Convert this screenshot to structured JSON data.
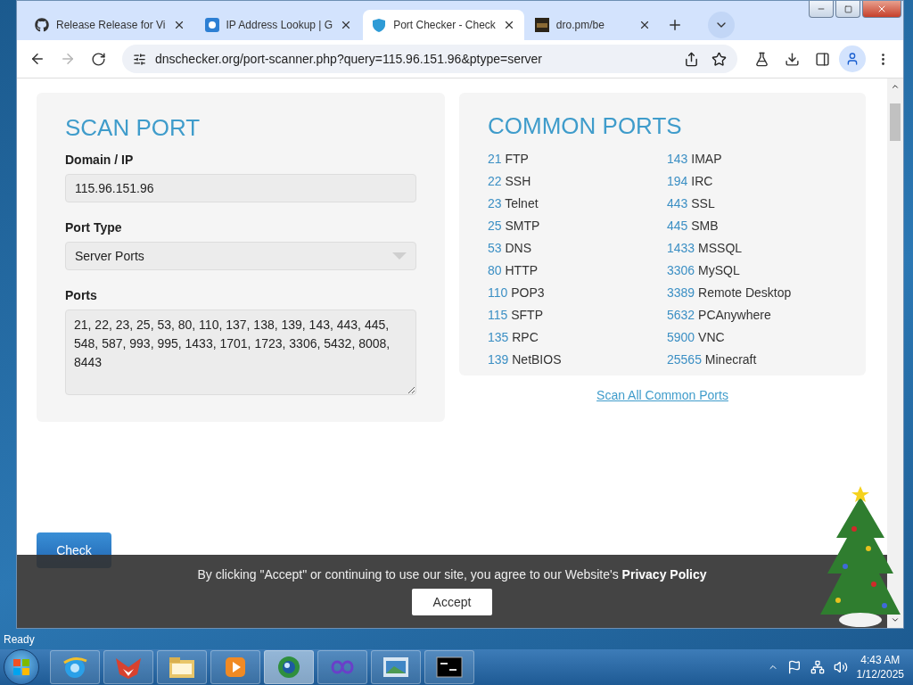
{
  "tabs": [
    {
      "title": "Release Release for Vi",
      "selected": false
    },
    {
      "title": "IP Address Lookup | G",
      "selected": false
    },
    {
      "title": "Port Checker - Check",
      "selected": true
    },
    {
      "title": "dro.pm/be",
      "selected": false
    }
  ],
  "toolbar": {
    "url": "dnschecker.org/port-scanner.php?query=115.96.151.96&ptype=server",
    "forward_disabled": true
  },
  "scan_port": {
    "title": "SCAN PORT",
    "domain_label": "Domain / IP",
    "domain_value": "115.96.151.96",
    "port_type_label": "Port Type",
    "port_type_value": "Server Ports",
    "ports_label": "Ports",
    "ports_value": "21, 22, 23, 25, 53, 80, 110, 137, 138, 139, 143, 443, 445, 548, 587, 993, 995, 1433, 1701, 1723, 3306, 5432, 8008, 8443"
  },
  "common_ports": {
    "title": "COMMON PORTS",
    "columns": [
      [
        {
          "port": "21",
          "name": "FTP"
        },
        {
          "port": "22",
          "name": "SSH"
        },
        {
          "port": "23",
          "name": "Telnet"
        },
        {
          "port": "25",
          "name": "SMTP"
        },
        {
          "port": "53",
          "name": "DNS"
        },
        {
          "port": "80",
          "name": "HTTP"
        },
        {
          "port": "110",
          "name": "POP3"
        },
        {
          "port": "115",
          "name": "SFTP"
        },
        {
          "port": "135",
          "name": "RPC"
        },
        {
          "port": "139",
          "name": "NetBIOS"
        }
      ],
      [
        {
          "port": "143",
          "name": "IMAP"
        },
        {
          "port": "194",
          "name": "IRC"
        },
        {
          "port": "443",
          "name": "SSL"
        },
        {
          "port": "445",
          "name": "SMB"
        },
        {
          "port": "1433",
          "name": "MSSQL"
        },
        {
          "port": "3306",
          "name": "MySQL"
        },
        {
          "port": "3389",
          "name": "Remote Desktop"
        },
        {
          "port": "5632",
          "name": "PCAnywhere"
        },
        {
          "port": "5900",
          "name": "VNC"
        },
        {
          "port": "25565",
          "name": "Minecraft"
        }
      ]
    ],
    "scan_all_link": "Scan All Common Ports"
  },
  "check_button": "Check",
  "cookie_banner": {
    "text": "By clicking \"Accept\" or continuing to use our site, you agree to our Website's **Privacy Policy**",
    "button": "Accept"
  },
  "status": "Ready",
  "taskbar": {
    "items": [
      {
        "kind": "ie",
        "selected": false
      },
      {
        "kind": "fox",
        "selected": false
      },
      {
        "kind": "folder",
        "selected": false
      },
      {
        "kind": "media",
        "selected": false
      },
      {
        "kind": "globe",
        "selected": true
      },
      {
        "kind": "infinity",
        "selected": false
      },
      {
        "kind": "window",
        "selected": false
      },
      {
        "kind": "terminal",
        "selected": false
      }
    ],
    "time": "4:43 AM",
    "date": "1/12/2025"
  }
}
